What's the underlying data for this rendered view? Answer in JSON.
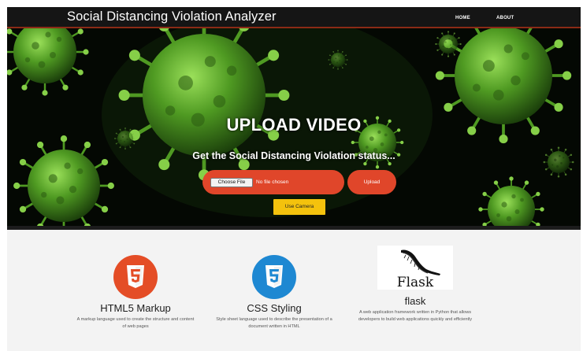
{
  "header": {
    "brand": "Social Distancing Violation Analyzer",
    "nav": [
      {
        "label": "HOME"
      },
      {
        "label": "ABOUT"
      }
    ]
  },
  "hero": {
    "title": "UPLOAD VIDEO",
    "subtitle": "Get the Social Distancing Violation status...",
    "choose_file_label": "Choose File",
    "no_file_text": "No file chosen",
    "upload_label": "Upload",
    "camera_label": "Use Camera"
  },
  "features": [
    {
      "icon": "html5-icon",
      "title": "HTML5 Markup",
      "description": "A markup language used to create the structure and content of web pages"
    },
    {
      "icon": "css3-icon",
      "title": "CSS Styling",
      "description": "Style sheet language used to describe the presentation of a document written in HTML"
    },
    {
      "icon": "flask-logo",
      "logo_text": "Flask",
      "title": "flask",
      "description": "A web application framework written in Python that allows developers to build web applications quickly and efficiently"
    }
  ],
  "colors": {
    "navbar": "#151515",
    "accent_red": "#e0462a",
    "camera_yellow": "#f4c20d",
    "html5_orange": "#e44d26",
    "css3_blue": "#1e88d2",
    "virus_green": "#5aa82c"
  }
}
